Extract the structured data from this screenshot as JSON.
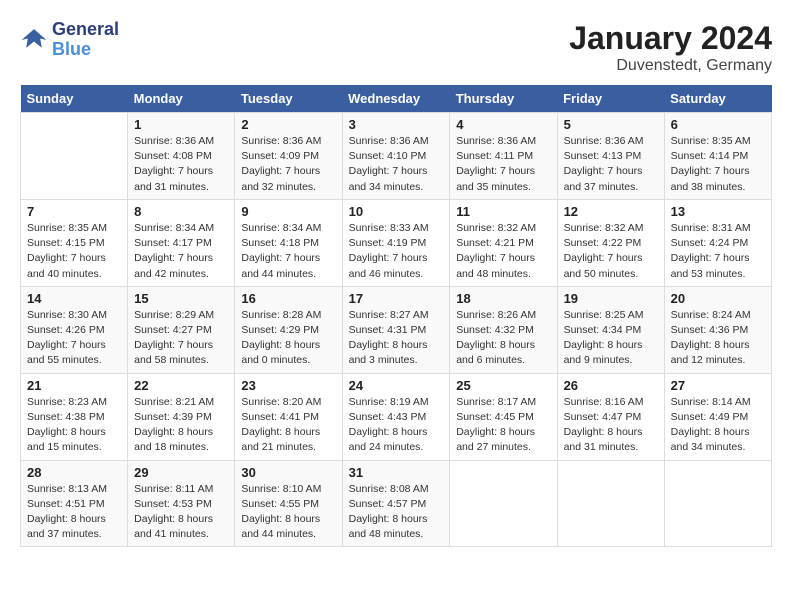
{
  "header": {
    "logo_line1": "General",
    "logo_line2": "Blue",
    "month": "January 2024",
    "location": "Duvenstedt, Germany"
  },
  "days_of_week": [
    "Sunday",
    "Monday",
    "Tuesday",
    "Wednesday",
    "Thursday",
    "Friday",
    "Saturday"
  ],
  "weeks": [
    [
      {
        "day": "",
        "info": ""
      },
      {
        "day": "1",
        "info": "Sunrise: 8:36 AM\nSunset: 4:08 PM\nDaylight: 7 hours\nand 31 minutes."
      },
      {
        "day": "2",
        "info": "Sunrise: 8:36 AM\nSunset: 4:09 PM\nDaylight: 7 hours\nand 32 minutes."
      },
      {
        "day": "3",
        "info": "Sunrise: 8:36 AM\nSunset: 4:10 PM\nDaylight: 7 hours\nand 34 minutes."
      },
      {
        "day": "4",
        "info": "Sunrise: 8:36 AM\nSunset: 4:11 PM\nDaylight: 7 hours\nand 35 minutes."
      },
      {
        "day": "5",
        "info": "Sunrise: 8:36 AM\nSunset: 4:13 PM\nDaylight: 7 hours\nand 37 minutes."
      },
      {
        "day": "6",
        "info": "Sunrise: 8:35 AM\nSunset: 4:14 PM\nDaylight: 7 hours\nand 38 minutes."
      }
    ],
    [
      {
        "day": "7",
        "info": "Sunrise: 8:35 AM\nSunset: 4:15 PM\nDaylight: 7 hours\nand 40 minutes."
      },
      {
        "day": "8",
        "info": "Sunrise: 8:34 AM\nSunset: 4:17 PM\nDaylight: 7 hours\nand 42 minutes."
      },
      {
        "day": "9",
        "info": "Sunrise: 8:34 AM\nSunset: 4:18 PM\nDaylight: 7 hours\nand 44 minutes."
      },
      {
        "day": "10",
        "info": "Sunrise: 8:33 AM\nSunset: 4:19 PM\nDaylight: 7 hours\nand 46 minutes."
      },
      {
        "day": "11",
        "info": "Sunrise: 8:32 AM\nSunset: 4:21 PM\nDaylight: 7 hours\nand 48 minutes."
      },
      {
        "day": "12",
        "info": "Sunrise: 8:32 AM\nSunset: 4:22 PM\nDaylight: 7 hours\nand 50 minutes."
      },
      {
        "day": "13",
        "info": "Sunrise: 8:31 AM\nSunset: 4:24 PM\nDaylight: 7 hours\nand 53 minutes."
      }
    ],
    [
      {
        "day": "14",
        "info": "Sunrise: 8:30 AM\nSunset: 4:26 PM\nDaylight: 7 hours\nand 55 minutes."
      },
      {
        "day": "15",
        "info": "Sunrise: 8:29 AM\nSunset: 4:27 PM\nDaylight: 7 hours\nand 58 minutes."
      },
      {
        "day": "16",
        "info": "Sunrise: 8:28 AM\nSunset: 4:29 PM\nDaylight: 8 hours\nand 0 minutes."
      },
      {
        "day": "17",
        "info": "Sunrise: 8:27 AM\nSunset: 4:31 PM\nDaylight: 8 hours\nand 3 minutes."
      },
      {
        "day": "18",
        "info": "Sunrise: 8:26 AM\nSunset: 4:32 PM\nDaylight: 8 hours\nand 6 minutes."
      },
      {
        "day": "19",
        "info": "Sunrise: 8:25 AM\nSunset: 4:34 PM\nDaylight: 8 hours\nand 9 minutes."
      },
      {
        "day": "20",
        "info": "Sunrise: 8:24 AM\nSunset: 4:36 PM\nDaylight: 8 hours\nand 12 minutes."
      }
    ],
    [
      {
        "day": "21",
        "info": "Sunrise: 8:23 AM\nSunset: 4:38 PM\nDaylight: 8 hours\nand 15 minutes."
      },
      {
        "day": "22",
        "info": "Sunrise: 8:21 AM\nSunset: 4:39 PM\nDaylight: 8 hours\nand 18 minutes."
      },
      {
        "day": "23",
        "info": "Sunrise: 8:20 AM\nSunset: 4:41 PM\nDaylight: 8 hours\nand 21 minutes."
      },
      {
        "day": "24",
        "info": "Sunrise: 8:19 AM\nSunset: 4:43 PM\nDaylight: 8 hours\nand 24 minutes."
      },
      {
        "day": "25",
        "info": "Sunrise: 8:17 AM\nSunset: 4:45 PM\nDaylight: 8 hours\nand 27 minutes."
      },
      {
        "day": "26",
        "info": "Sunrise: 8:16 AM\nSunset: 4:47 PM\nDaylight: 8 hours\nand 31 minutes."
      },
      {
        "day": "27",
        "info": "Sunrise: 8:14 AM\nSunset: 4:49 PM\nDaylight: 8 hours\nand 34 minutes."
      }
    ],
    [
      {
        "day": "28",
        "info": "Sunrise: 8:13 AM\nSunset: 4:51 PM\nDaylight: 8 hours\nand 37 minutes."
      },
      {
        "day": "29",
        "info": "Sunrise: 8:11 AM\nSunset: 4:53 PM\nDaylight: 8 hours\nand 41 minutes."
      },
      {
        "day": "30",
        "info": "Sunrise: 8:10 AM\nSunset: 4:55 PM\nDaylight: 8 hours\nand 44 minutes."
      },
      {
        "day": "31",
        "info": "Sunrise: 8:08 AM\nSunset: 4:57 PM\nDaylight: 8 hours\nand 48 minutes."
      },
      {
        "day": "",
        "info": ""
      },
      {
        "day": "",
        "info": ""
      },
      {
        "day": "",
        "info": ""
      }
    ]
  ]
}
